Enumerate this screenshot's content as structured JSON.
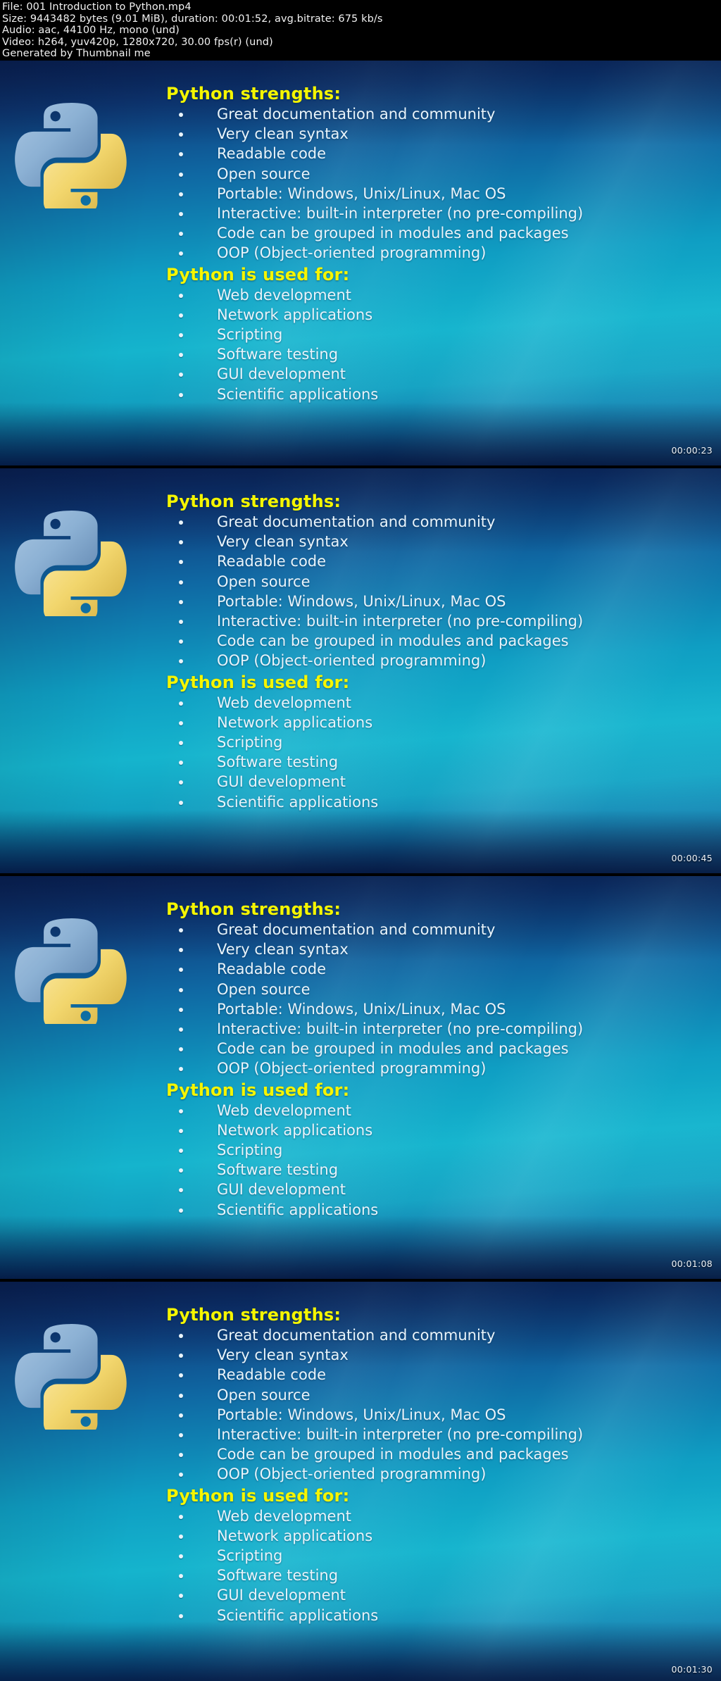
{
  "header": {
    "lines": [
      "File: 001 Introduction to Python.mp4",
      "Size: 9443482 bytes (9.01 MiB), duration: 00:01:52, avg.bitrate: 675 kb/s",
      "Audio: aac, 44100 Hz, mono (und)",
      "Video: h264, yuv420p, 1280x720, 30.00 fps(r) (und)",
      "Generated by Thumbnail me"
    ],
    "file_name": "001 Introduction to Python.mp4",
    "size_bytes": "9443482",
    "size_human": "9.01 MiB",
    "duration": "00:01:52",
    "avg_bitrate": "675 kb/s",
    "audio_codec": "aac",
    "audio_rate": "44100 Hz",
    "audio_channels": "mono (und)",
    "video_codec": "h264",
    "pixel_format": "yuv420p",
    "resolution": "1280x720",
    "fps": "30.00 fps(r) (und)",
    "generator": "Generated by Thumbnail me"
  },
  "slide": {
    "logo_icon": "python-logo-icon",
    "heading_strengths": "Python strengths:",
    "strengths": [
      "Great documentation and community",
      "Very clean syntax",
      "Readable code",
      "Open source",
      "Portable: Windows, Unix/Linux, Mac OS",
      "Interactive: built-in interpreter (no pre-compiling)",
      "Code can be grouped in modules and packages",
      "OOP (Object-oriented programming)"
    ],
    "heading_used_for": "Python is used for:",
    "used_for": [
      "Web development",
      "Network applications",
      "Scripting",
      "Software testing",
      "GUI development",
      "Scientific applications"
    ]
  },
  "frames": [
    {
      "timestamp": "00:00:23"
    },
    {
      "timestamp": "00:00:45"
    },
    {
      "timestamp": "00:01:08"
    },
    {
      "timestamp": "00:01:30"
    }
  ],
  "colors": {
    "heading": "#F5F500",
    "body_text": "#E9F4FB",
    "background_dark": "#000000",
    "slide_teal": "#15B4CD",
    "slide_navy": "#0D2A63",
    "python_blue": "#8FB4D9",
    "python_yellow": "#F0D264"
  }
}
